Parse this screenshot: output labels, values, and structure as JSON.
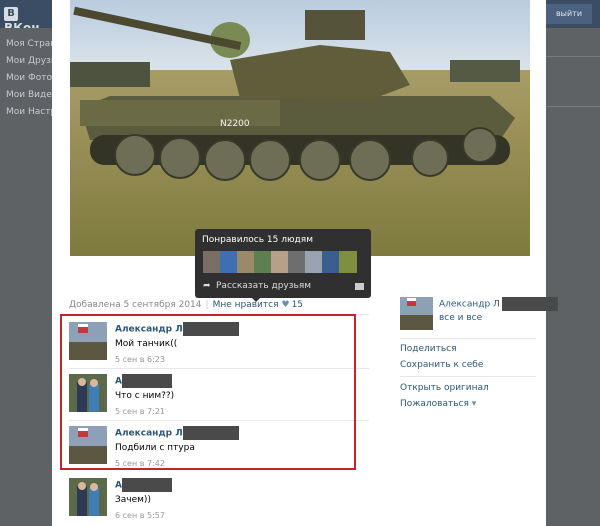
{
  "site": {
    "logo": "ВКон",
    "logout": "выйти"
  },
  "sidebar": {
    "items": [
      "Моя Страница",
      "Мои Друзья",
      "Мои Фотографии",
      "Мои Видео",
      "Мои Настройки"
    ]
  },
  "photo": {
    "added": "Добавлена 5 сентября 2014",
    "likes_label": "Мне нравится",
    "heart": "♥",
    "likes_count": "15"
  },
  "tooltip": {
    "title": "Понравилось 15 людям",
    "share": "Рассказать друзьям",
    "face_colors": [
      "#7a6f64",
      "#3f6fb0",
      "#9b8a6a",
      "#5e7f4f",
      "#b7a08a",
      "#6e6e6e",
      "#9aa4b0",
      "#3a5f8f",
      "#7f8f3f"
    ]
  },
  "comments": [
    {
      "name": "Александр Л",
      "text": "Мой танчик((",
      "time": "5 сен в 6:23"
    },
    {
      "name": "А",
      "text": "Что с ним??)",
      "time": "5 сен в 7:21"
    },
    {
      "name": "Александр Л",
      "text": "Подбили с птура",
      "time": "5 сен в 7:42"
    },
    {
      "name": "А",
      "text": "Зачем))",
      "time": "6 сен в 5:57"
    }
  ],
  "owner": {
    "name": "Александр Л",
    "privacy": "все и все"
  },
  "actions": {
    "share": "Поделиться",
    "save": "Сохранить к себе",
    "original": "Открыть оригинал",
    "report": "Пожаловаться",
    "report_arrow": "▾"
  },
  "colors": {
    "highlight": "#c8232c",
    "link": "#2b587a"
  }
}
